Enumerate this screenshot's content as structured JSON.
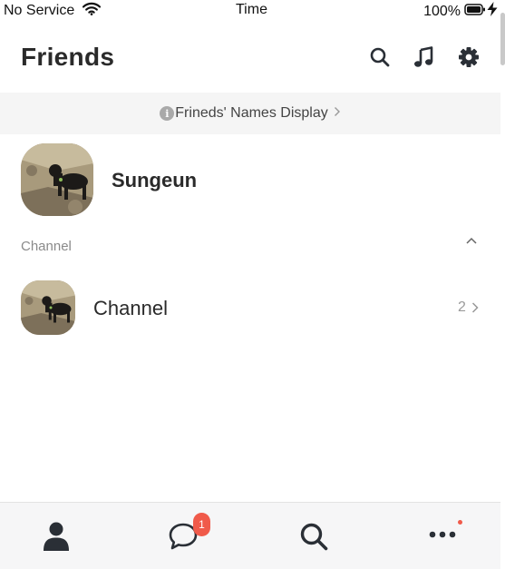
{
  "status_bar": {
    "carrier": "No Service",
    "time": "Time",
    "battery": "100%"
  },
  "header": {
    "title": "Friends"
  },
  "names_banner": {
    "text": "Frineds' Names Display"
  },
  "profile": {
    "name": "Sungeun"
  },
  "channel_section": {
    "label": "Channel",
    "items": [
      {
        "name": "Channel",
        "count": "2"
      }
    ]
  },
  "tab_bar": {
    "chats_badge": "1"
  },
  "colors": {
    "badge": "#f05a4a",
    "icon": "#2a2f36",
    "banner_bg": "#f5f5f5",
    "tab_bar_bg": "#f6f6f7"
  }
}
